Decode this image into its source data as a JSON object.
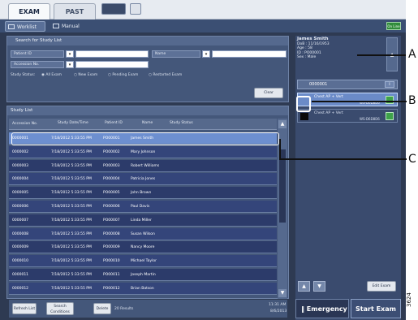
{
  "tabs": {
    "exam": "EXAM",
    "past": "PAST"
  },
  "subtabs": {
    "worklist": "Worklist",
    "manual": "Manual",
    "online": "On Line"
  },
  "search": {
    "header": "Search for Study List",
    "patient_id_label": "Patient ID",
    "name_label": "Name",
    "accession_label": "Accession No.",
    "status_label": "Study Status:",
    "radio_all": "All Exam",
    "radio_new": "New Exam",
    "radio_pending": "Pending Exam",
    "radio_restarted": "Restarted Exam",
    "clear": "Clear"
  },
  "study_list": {
    "header": "Study List",
    "columns": [
      "Accession No.",
      "Study Date/Time",
      "Patient ID",
      "Name",
      "Study Status"
    ],
    "rows": [
      {
        "acc": "0000001",
        "date": "7/18/2012 5:33:55 PM",
        "pid": "PO00001",
        "name": "James Smith"
      },
      {
        "acc": "0000002",
        "date": "7/18/2012 5:33:55 PM",
        "pid": "PO00002",
        "name": "Mary Johnson"
      },
      {
        "acc": "0000003",
        "date": "7/18/2012 5:33:55 PM",
        "pid": "PO00003",
        "name": "Robert Williams"
      },
      {
        "acc": "0000004",
        "date": "7/18/2012 5:33:55 PM",
        "pid": "PO00004",
        "name": "Patricia Jones"
      },
      {
        "acc": "0000005",
        "date": "7/18/2012 5:33:55 PM",
        "pid": "PO00005",
        "name": "John Brown"
      },
      {
        "acc": "0000006",
        "date": "7/18/2012 5:33:55 PM",
        "pid": "PO00006",
        "name": "Paul Davis"
      },
      {
        "acc": "0000007",
        "date": "7/18/2012 5:33:55 PM",
        "pid": "PO00007",
        "name": "Linda Miller"
      },
      {
        "acc": "0000008",
        "date": "7/18/2012 5:33:55 PM",
        "pid": "PO00008",
        "name": "Susan Wilson"
      },
      {
        "acc": "0000009",
        "date": "7/18/2012 5:33:55 PM",
        "pid": "PO00009",
        "name": "Nancy Moore"
      },
      {
        "acc": "0000010",
        "date": "7/18/2012 5:33:55 PM",
        "pid": "PO00010",
        "name": "Michael Taylor"
      },
      {
        "acc": "0000011",
        "date": "7/18/2012 5:33:55 PM",
        "pid": "PO00011",
        "name": "Joseph Martin"
      },
      {
        "acc": "0000012",
        "date": "7/18/2012 5:33:55 PM",
        "pid": "PO00012",
        "name": "Brian Batson"
      }
    ],
    "selected_index": 0
  },
  "footer": {
    "refresh": "Refresh List",
    "search_conditions": "Search Conditions",
    "delete": "Delete",
    "results": "20 Results",
    "time": "11:31 AM",
    "date": "8/6/2013"
  },
  "patient": {
    "name": "James Smith",
    "dob": "DoB : 11/16/1953",
    "age": "Age : 58",
    "id": "ID : PO00001",
    "sex": "Sex : Male",
    "accession": "0000001",
    "exam_items": [
      {
        "title": "Chest AP + Vert",
        "code": "WS-D6D8D6"
      },
      {
        "title": "Chest AP + Vert",
        "code": "WS-D6D8D6"
      }
    ]
  },
  "actions": {
    "edit_exam": "Edit Exam",
    "emergency": "Emergency",
    "start_exam": "Start Exam"
  },
  "callouts": {
    "a": "A",
    "b": "B",
    "c": "C"
  },
  "figure_number": "3624"
}
